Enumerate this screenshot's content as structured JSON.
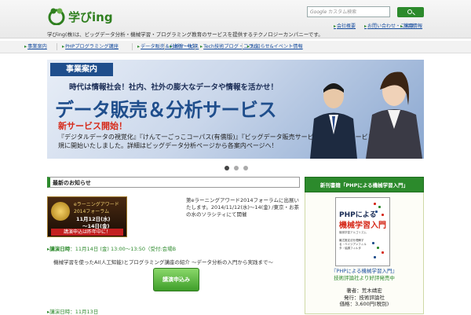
{
  "header": {
    "logo_text": "学びing",
    "tagline": "学びing(株)は、ビッグデータ分析・機械学習・プログラミング教育のサービスを提供するテクノロジーカンパニーです。",
    "search_placeholder": "カスタム検索",
    "search_prefix": "Google",
    "top_links": [
      "会社概要",
      "お問い合わせ・ご相談",
      "採用情報"
    ]
  },
  "nav": {
    "items": [
      "事業案内",
      "PHPプログラミング講座",
      "データ販売＆分析サービス",
      "出版・執筆",
      "Tech技術ブログ・コラム",
      "お知らせ&イベント情報"
    ]
  },
  "banner": {
    "tag": "事業案内",
    "lead": "時代は情報社会！社内、社外の膨大なデータや情報を活かせ！",
    "title": "データ販売＆分析サービス",
    "new_label": "新サービス開始！",
    "desc": "『デジタルデータの視覚化』『けんて一ごっこコーパス(有償版)』『ビッグデータ販売サービス』の3つのサービスを新規に開始いたしました。詳細はビッグデータ分析ページから各案内ページへ！"
  },
  "main": {
    "section_title": "最新のお知らせ",
    "award": {
      "line1": "eラーニングアワード",
      "line2": "2014フォーラム",
      "line3": "11月12日(水)",
      "line4": "〜14日(金)",
      "line5": "講演申込は昨年中に！"
    },
    "news_text": "第eラーニングアワード2014フォーラムに出展いたします。2014/11/12(水)〜14(金) /東京・お茶の水のソラシティにて開催",
    "event_time_label": "講演日時",
    "event_time": "：11月14日 (金) 13:00〜13:50（受付:会場B",
    "event_desc": "機械学習を使ったAI(人工知能)とプログラミング講座の紹介 〜データ分析の入門から実践まで〜",
    "apply_label": "講演申込み",
    "event2": "講演日時：11月13日"
  },
  "sidebar": {
    "header": "新刊書籍「PHPによる機械学習入門」",
    "book": {
      "title1": "PHPによる",
      "title2": "機械学習入門",
      "subtitle": "機械学習アルゴリズム",
      "blurb": "最尤推定法を理解する・ベイジアンフィルタ・協調フィルタ"
    },
    "link1": "『PHPによる機械学習入門』",
    "link2": "技術評論社より好評発売中",
    "info_line1": "著者：荒木靖宏",
    "info_line2": "発行：技術評論社",
    "info_line3": "価格：3,600円(税別)"
  },
  "carousel": {
    "total": 3,
    "active": 1
  },
  "colors": {
    "accent_green": "#2c8a2c",
    "link_blue": "#1a4fa0",
    "banner_blue": "#1f4e8c",
    "alert_red": "#d62a1a"
  }
}
